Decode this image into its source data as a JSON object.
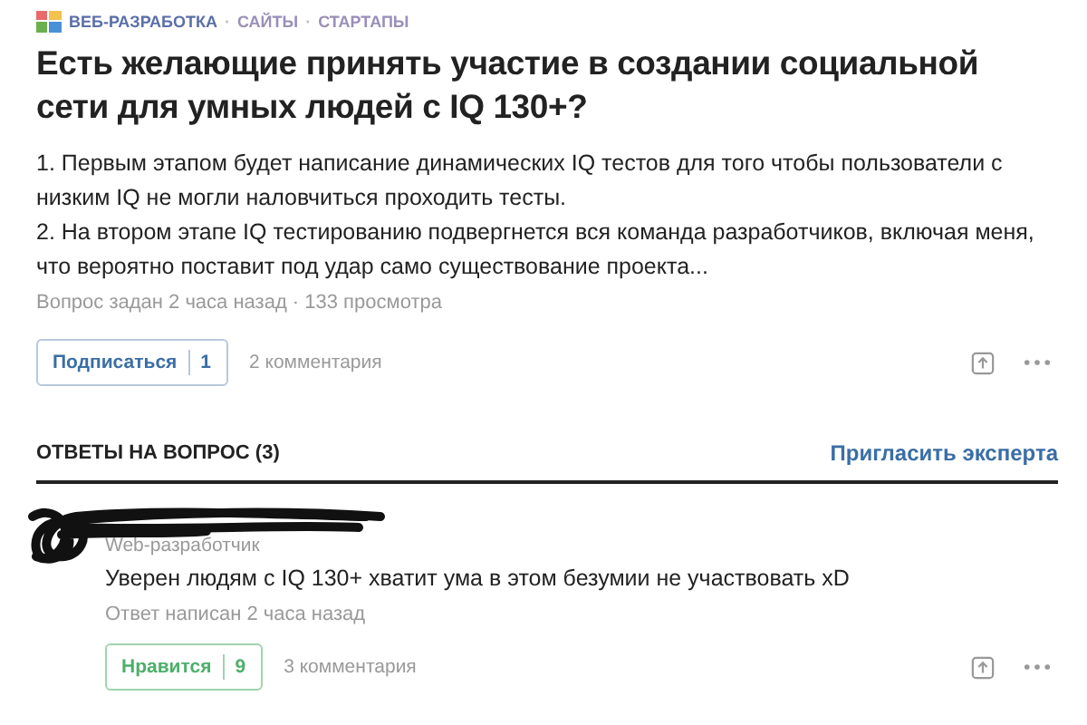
{
  "tags": [
    "ВЕБ-РАЗРАБОТКА",
    "САЙТЫ",
    "СТАРТАПЫ"
  ],
  "tag_separator": "·",
  "question": {
    "title": "Есть желающие принять участие в создании социальной сети для умных людей с IQ 130+?",
    "paragraphs": [
      "1. Первым этапом будет написание динамических IQ тестов для того чтобы пользователи с низким IQ не могли наловчиться проходить тесты.",
      "2. На втором этапе IQ тестированию подвергнется вся команда разработчиков, включая меня, что вероятно поставит под удар само существование проекта..."
    ],
    "meta": "Вопрос задан 2 часа назад · 133 просмотра",
    "subscribe": {
      "label": "Подписаться",
      "count": "1"
    },
    "comments": "2 комментария"
  },
  "answers_header": {
    "title": "ОТВЕТЫ НА ВОПРОС (3)",
    "invite": "Пригласить эксперта"
  },
  "answers": [
    {
      "author_redacted": true,
      "role": "Web-разработчик",
      "text": "Уверен людям с IQ 130+ хватит ума в этом безумии не участвовать xD",
      "meta": "Ответ написан 2 часа назад",
      "like": {
        "label": "Нравится",
        "count": "9"
      },
      "comments": "3 комментария"
    }
  ]
}
